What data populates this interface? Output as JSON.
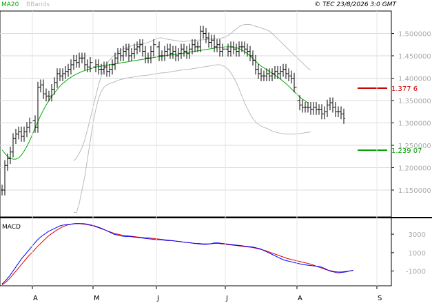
{
  "header": {
    "ma_label": "MA20",
    "bb_label": "BBands",
    "copyright": "© TEC 23/8/2026 3:0 GMT"
  },
  "colors": {
    "ma": "#00aa00",
    "bbands": "#bbbbbb",
    "macd": "#0000ff",
    "signal": "#dd0000",
    "level_red": "#cc0000",
    "level_green": "#009900",
    "bars": "#000000"
  },
  "chart_data": [
    {
      "type": "ohlc",
      "title": "",
      "ylim": [
        1.09,
        1.55
      ],
      "y_ticks": [
        1.15,
        1.2,
        1.25,
        1.3,
        1.35,
        1.4,
        1.45,
        1.5
      ],
      "y_tick_labels": [
        "1.150000",
        "1.200000",
        "1.250000",
        "1.300000",
        "1.350000",
        "1.400000",
        "1.450000",
        "1.500000"
      ],
      "grid": true,
      "x_month_labels": [
        {
          "label": "A",
          "index": 11
        },
        {
          "label": "M",
          "index": 33
        },
        {
          "label": "J",
          "index": 56
        },
        {
          "label": "J",
          "index": 81
        },
        {
          "label": "A",
          "index": 107
        },
        {
          "label": "S",
          "index": 136
        }
      ],
      "n_slots": 138,
      "price_close": [
        1.15,
        1.205,
        1.22,
        1.235,
        1.265,
        1.275,
        1.28,
        1.27,
        1.28,
        1.29,
        1.3,
        1.305,
        1.29,
        1.38,
        1.385,
        1.365,
        1.36,
        1.36,
        1.375,
        1.39,
        1.41,
        1.405,
        1.41,
        1.415,
        1.42,
        1.43,
        1.44,
        1.435,
        1.445,
        1.445,
        1.43,
        1.425,
        1.435,
        1.425,
        1.43,
        1.42,
        1.42,
        1.425,
        1.415,
        1.42,
        1.43,
        1.445,
        1.455,
        1.45,
        1.46,
        1.465,
        1.45,
        1.455,
        1.465,
        1.47,
        1.475,
        1.46,
        1.445,
        1.445,
        1.46,
        1.475,
        1.47,
        1.45,
        1.45,
        1.46,
        1.465,
        1.455,
        1.46,
        1.45,
        1.455,
        1.465,
        1.46,
        1.455,
        1.465,
        1.475,
        1.47,
        1.47,
        1.505,
        1.5,
        1.49,
        1.48,
        1.485,
        1.47,
        1.475,
        1.46,
        1.465,
        1.465,
        1.46,
        1.47,
        1.465,
        1.46,
        1.47,
        1.47,
        1.465,
        1.46,
        1.45,
        1.44,
        1.42,
        1.41,
        1.405,
        1.405,
        1.41,
        1.405,
        1.41,
        1.415,
        1.41,
        1.415,
        1.42,
        1.41,
        1.405,
        1.4,
        1.38,
        1.35,
        1.34,
        1.335,
        1.335,
        1.335,
        1.33,
        1.335,
        1.33,
        1.33,
        1.32,
        1.325,
        1.34,
        1.345,
        1.335,
        1.325,
        1.325,
        1.32,
        1.31
      ],
      "ma20": [
        1.24,
        1.232,
        1.225,
        1.221,
        1.219,
        1.219,
        1.222,
        1.228,
        1.237,
        1.248,
        1.26,
        1.274,
        1.289,
        1.303,
        1.317,
        1.329,
        1.34,
        1.35,
        1.359,
        1.367,
        1.375,
        1.382,
        1.388,
        1.393,
        1.398,
        1.402,
        1.406,
        1.409,
        1.412,
        1.415,
        1.417,
        1.419,
        1.421,
        1.423,
        1.425,
        1.426,
        1.427,
        1.428,
        1.429,
        1.43,
        1.431,
        1.432,
        1.433,
        1.434,
        1.435,
        1.436,
        1.437,
        1.438,
        1.439,
        1.44,
        1.441,
        1.442,
        1.443,
        1.444,
        1.445,
        1.446,
        1.447,
        1.448,
        1.449,
        1.45,
        1.451,
        1.452,
        1.452,
        1.453,
        1.454,
        1.455,
        1.456,
        1.457,
        1.458,
        1.459,
        1.46,
        1.461,
        1.462,
        1.463,
        1.464,
        1.465,
        1.466,
        1.467,
        1.468,
        1.469,
        1.469,
        1.47,
        1.47,
        1.47,
        1.469,
        1.468,
        1.466,
        1.463,
        1.459,
        1.455,
        1.45,
        1.444,
        1.438,
        1.432,
        1.427,
        1.423,
        1.419,
        1.415,
        1.411,
        1.407,
        1.403,
        1.398,
        1.393,
        1.388,
        1.382,
        1.376,
        1.37,
        1.364,
        1.358,
        1.353,
        1.349,
        1.345
      ],
      "bb_upper": [
        1.215,
        1.222,
        1.232,
        1.245,
        1.262,
        1.285,
        1.31,
        1.335,
        1.36,
        1.385,
        1.405,
        1.42,
        1.432,
        1.44,
        1.447,
        1.452,
        1.457,
        1.462,
        1.465,
        1.468,
        1.47,
        1.472,
        1.474,
        1.475,
        1.476,
        1.477,
        1.478,
        1.48,
        1.482,
        1.485,
        1.488,
        1.49,
        1.49,
        1.488,
        1.487,
        1.486,
        1.485,
        1.484,
        1.483,
        1.482,
        1.482,
        1.483,
        1.483,
        1.484,
        1.484,
        1.485,
        1.485,
        1.486,
        1.486,
        1.487,
        1.487,
        1.488,
        1.488,
        1.489,
        1.49,
        1.492,
        1.495,
        1.5,
        1.505,
        1.51,
        1.515,
        1.518,
        1.52,
        1.52,
        1.52,
        1.518,
        1.516,
        1.514,
        1.512,
        1.51,
        1.508,
        1.505,
        1.5,
        1.494,
        1.488,
        1.482,
        1.476,
        1.47,
        1.464,
        1.458,
        1.452,
        1.446,
        1.44,
        1.434,
        1.428,
        1.422,
        1.418
      ],
      "bb_lower": [
        1.1,
        1.1,
        1.12,
        1.15,
        1.18,
        1.22,
        1.26,
        1.3,
        1.33,
        1.355,
        1.37,
        1.38,
        1.385,
        1.388,
        1.39,
        1.392,
        1.395,
        1.397,
        1.398,
        1.4,
        1.401,
        1.402,
        1.403,
        1.404,
        1.405,
        1.406,
        1.406,
        1.407,
        1.408,
        1.409,
        1.41,
        1.411,
        1.412,
        1.412,
        1.413,
        1.414,
        1.415,
        1.416,
        1.417,
        1.418,
        1.419,
        1.42,
        1.42,
        1.421,
        1.422,
        1.423,
        1.424,
        1.425,
        1.426,
        1.427,
        1.428,
        1.429,
        1.43,
        1.43,
        1.428,
        1.425,
        1.42,
        1.412,
        1.402,
        1.39,
        1.376,
        1.36,
        1.345,
        1.332,
        1.32,
        1.31,
        1.302,
        1.297,
        1.293,
        1.29,
        1.288,
        1.285,
        1.282,
        1.28,
        1.278,
        1.277,
        1.276,
        1.275,
        1.275,
        1.275,
        1.275,
        1.276,
        1.276,
        1.277,
        1.278,
        1.279,
        1.28
      ],
      "levels": [
        {
          "value": 1.3776,
          "label": "1.377 6",
          "color": "red"
        },
        {
          "value": 1.2391,
          "label": "1.239 07",
          "color": "green"
        }
      ]
    },
    {
      "type": "line",
      "title": "MACD",
      "ylim": [
        -2600,
        4800
      ],
      "y_ticks": [
        3000,
        1000,
        -1000
      ],
      "y_tick_labels": [
        "3000",
        "1000",
        "-1000"
      ],
      "series": [
        {
          "name": "MACD",
          "values": [
            -2400,
            -2000,
            -1500,
            -900,
            -300,
            300,
            800,
            1300,
            1800,
            2300,
            2700,
            3000,
            3300,
            3500,
            3700,
            3900,
            4000,
            4050,
            4100,
            4150,
            4150,
            4150,
            4100,
            4000,
            3900,
            3750,
            3600,
            3400,
            3200,
            3000,
            2900,
            2800,
            2750,
            2750,
            2700,
            2650,
            2600,
            2550,
            2500,
            2450,
            2400,
            2400,
            2350,
            2300,
            2300,
            2250,
            2200,
            2150,
            2100,
            2050,
            2000,
            1950,
            1900,
            1900,
            1950,
            2050,
            2050,
            2000,
            1950,
            1900,
            1850,
            1800,
            1750,
            1700,
            1650,
            1600,
            1500,
            1400,
            1200,
            1000,
            800,
            600,
            400,
            200,
            100,
            0,
            -100,
            -200,
            -300,
            -350,
            -400,
            -450,
            -500,
            -600,
            -800,
            -1000,
            -1100,
            -1200,
            -1150,
            -1100,
            -1000,
            -900
          ]
        },
        {
          "name": "Signal",
          "values": [
            -2500,
            -2200,
            -1800,
            -1300,
            -800,
            -300,
            200,
            700,
            1100,
            1600,
            2000,
            2400,
            2800,
            3100,
            3400,
            3650,
            3850,
            4000,
            4100,
            4150,
            4150,
            4100,
            4050,
            3950,
            3850,
            3700,
            3550,
            3400,
            3250,
            3100,
            3000,
            2900,
            2850,
            2800,
            2750,
            2700,
            2650,
            2600,
            2600,
            2550,
            2500,
            2450,
            2400,
            2350,
            2300,
            2250,
            2200,
            2150,
            2100,
            2050,
            2000,
            2000,
            1950,
            1950,
            1950,
            2000,
            2000,
            1950,
            1900,
            1850,
            1800,
            1750,
            1700,
            1650,
            1600,
            1550,
            1450,
            1350,
            1250,
            1100,
            950,
            800,
            650,
            500,
            350,
            250,
            150,
            50,
            -50,
            -150,
            -250,
            -400,
            -550,
            -700,
            -850,
            -950,
            -1050,
            -1100,
            -1100,
            -1050,
            -1000,
            -950
          ]
        }
      ]
    }
  ]
}
